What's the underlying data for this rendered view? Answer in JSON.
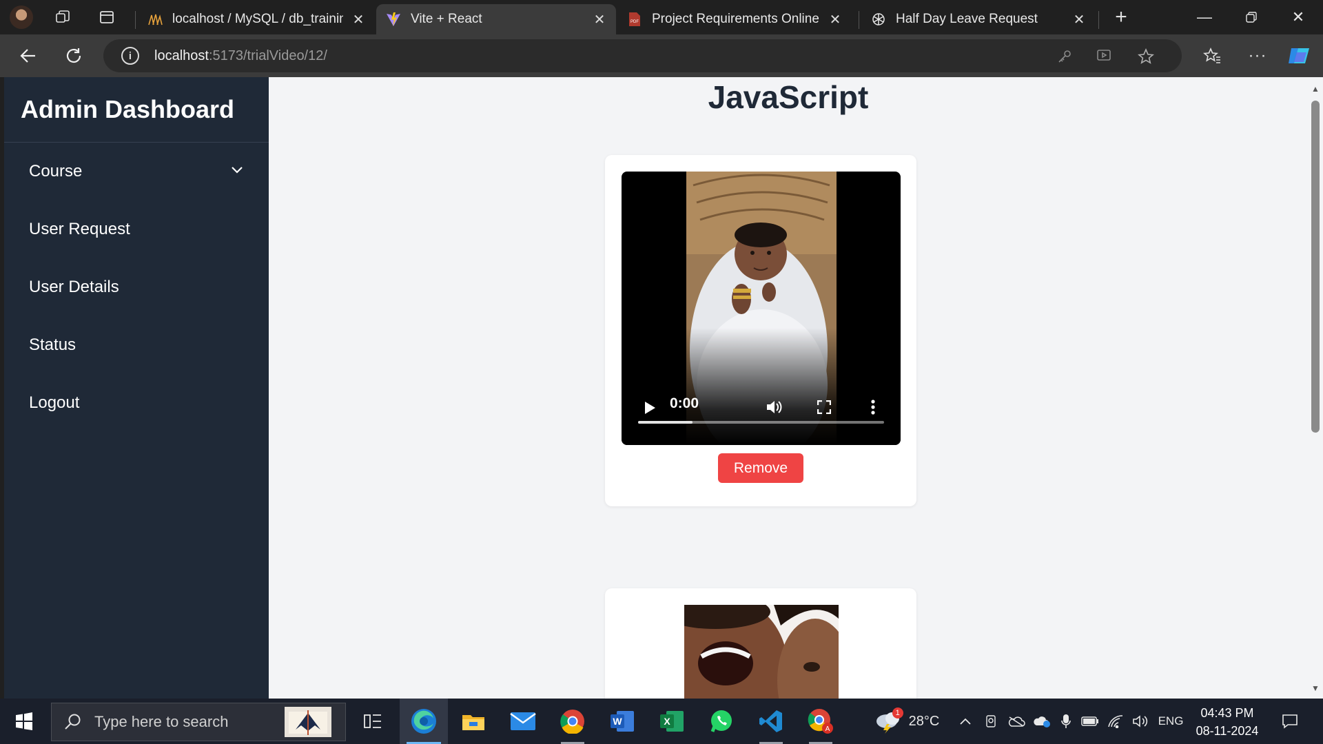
{
  "browser": {
    "tabs": [
      {
        "title": "localhost / MySQL / db_training",
        "icon": "phpmyadmin-icon"
      },
      {
        "title": "Vite + React",
        "icon": "vite-icon",
        "active": true
      },
      {
        "title": "Project Requirements Online Trai",
        "icon": "pdf-icon"
      },
      {
        "title": "Half Day Leave Request",
        "icon": "chatgpt-icon"
      }
    ],
    "url_host": "localhost",
    "url_path": ":5173/trialVideo/12/"
  },
  "app": {
    "brand": "Admin Dashboard",
    "nav": [
      {
        "label": "Course",
        "has_dropdown": true
      },
      {
        "label": "User Request"
      },
      {
        "label": "User Details"
      },
      {
        "label": "Status"
      },
      {
        "label": "Logout"
      }
    ]
  },
  "main": {
    "title": "JavaScript",
    "video": {
      "time": "0:00",
      "buffered_fraction": 0.22
    },
    "remove_label": "Remove"
  },
  "taskbar": {
    "search_placeholder": "Type here to search",
    "weather_temp": "28°C",
    "weather_badge": "1",
    "language": "ENG",
    "time": "04:43 PM",
    "date": "08-11-2024"
  },
  "colors": {
    "sidebar": "#1f2937",
    "page_bg": "#f3f4f6",
    "remove_button": "#ef4444",
    "browser_dark": "#202020",
    "taskbar": "#1a1f2b"
  }
}
